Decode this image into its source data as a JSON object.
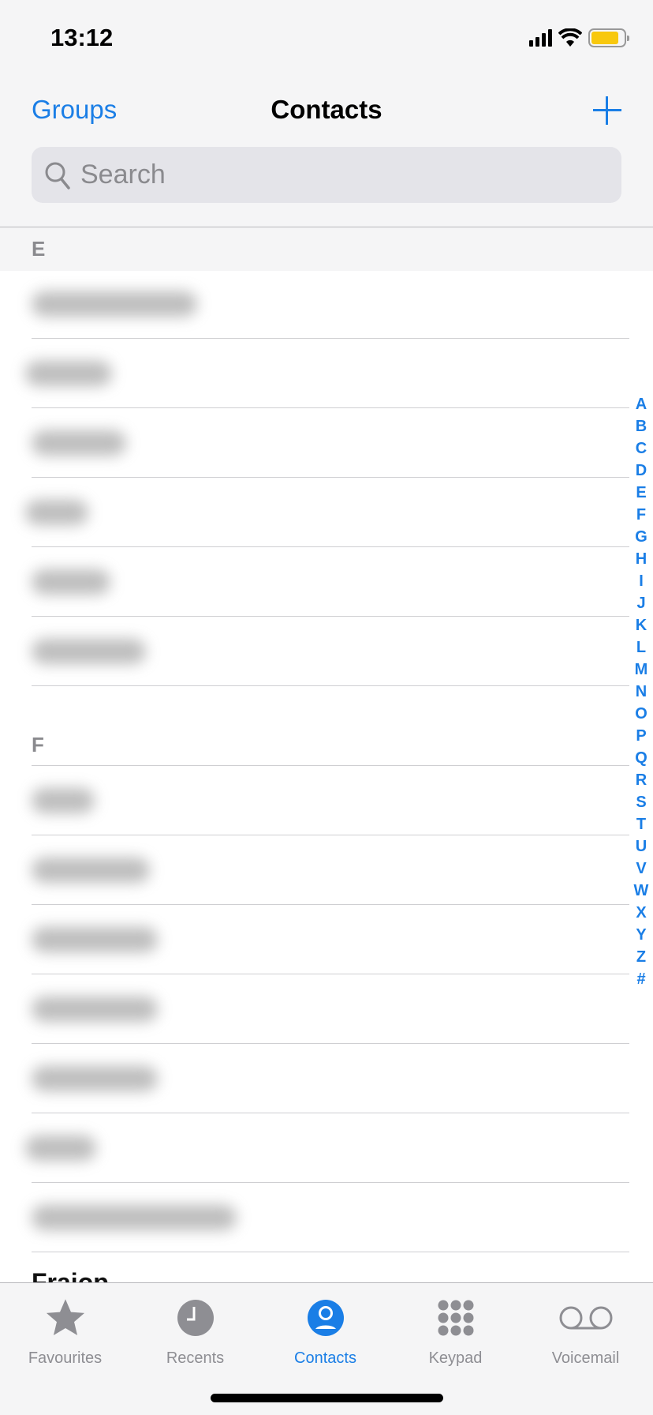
{
  "status_bar": {
    "time": "13:12",
    "battery_color": "#f8c80e"
  },
  "nav": {
    "left_button": "Groups",
    "title": "Contacts",
    "add_icon": "plus-icon"
  },
  "search": {
    "placeholder": "Search"
  },
  "sections": [
    {
      "letter": "E",
      "rows": 6
    },
    {
      "letter": "F",
      "rows": 7
    }
  ],
  "partial_next_item": "Fraiop",
  "index_letters": [
    "A",
    "B",
    "C",
    "D",
    "E",
    "F",
    "G",
    "H",
    "I",
    "J",
    "K",
    "L",
    "M",
    "N",
    "O",
    "P",
    "Q",
    "R",
    "S",
    "T",
    "U",
    "V",
    "W",
    "X",
    "Y",
    "Z",
    "#"
  ],
  "tabs": [
    {
      "label": "Favourites",
      "icon": "star-icon"
    },
    {
      "label": "Recents",
      "icon": "clock-icon"
    },
    {
      "label": "Contacts",
      "icon": "person-circle-icon",
      "active": true
    },
    {
      "label": "Keypad",
      "icon": "keypad-icon"
    },
    {
      "label": "Voicemail",
      "icon": "voicemail-icon"
    }
  ],
  "accent": "#1a7ee6"
}
